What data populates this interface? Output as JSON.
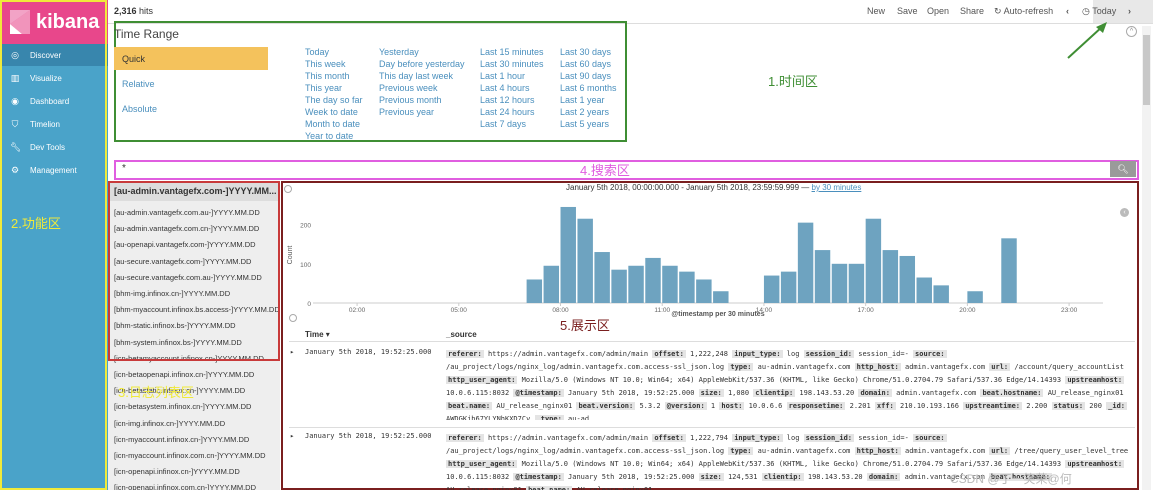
{
  "app": {
    "name": "kibana"
  },
  "sidebar": {
    "items": [
      {
        "label": "Discover",
        "icon": "compass-icon"
      },
      {
        "label": "Visualize",
        "icon": "bar-chart-icon"
      },
      {
        "label": "Dashboard",
        "icon": "dashboard-icon"
      },
      {
        "label": "Timelion",
        "icon": "shield-icon"
      },
      {
        "label": "Dev Tools",
        "icon": "wrench-icon"
      },
      {
        "label": "Management",
        "icon": "gear-icon"
      }
    ],
    "annotation": "2.功能区"
  },
  "topbar": {
    "hits_count": "2,316",
    "hits_label": "hits",
    "new": "New",
    "save": "Save",
    "open": "Open",
    "share": "Share",
    "auto_refresh": "Auto-refresh",
    "today": "Today"
  },
  "time_range": {
    "title": "Time Range",
    "types": [
      "Quick",
      "Relative",
      "Absolute"
    ],
    "col1": [
      "Today",
      "This week",
      "This month",
      "This year",
      "The day so far",
      "Week to date",
      "Month to date",
      "Year to date"
    ],
    "col2": [
      "Yesterday",
      "Day before yesterday",
      "This day last week",
      "Previous week",
      "Previous month",
      "Previous year"
    ],
    "col3": [
      "Last 15 minutes",
      "Last 30 minutes",
      "Last 1 hour",
      "Last 4 hours",
      "Last 12 hours",
      "Last 24 hours",
      "Last 7 days"
    ],
    "col4": [
      "Last 30 days",
      "Last 60 days",
      "Last 90 days",
      "Last 6 months",
      "Last 1 year",
      "Last 2 years",
      "Last 5 years"
    ],
    "annotation": "1.时间区"
  },
  "search": {
    "query": "*",
    "annotation": "4.搜索区"
  },
  "index_list": {
    "selected": "[au-admin.vantagefx.com-]YYYY.MM...",
    "items": [
      "[au-admin.vantagefx.com.au-]YYYY.MM.DD",
      "[au-admin.vantagefx.com.cn-]YYYY.MM.DD",
      "[au-openapi.vantagefx.com-]YYYY.MM.DD",
      "[au-secure.vantagefx.com-]YYYY.MM.DD",
      "[au-secure.vantagefx.com.au-]YYYY.MM.DD",
      "[bhm-img.infinox.cn-]YYYY.MM.DD",
      "[bhm-myaccount.infinox.bs.access-]YYYY.MM.DD",
      "[bhm-static.infinox.bs-]YYYY.MM.DD",
      "[bhm-system.infinox.bs-]YYYY.MM.DD",
      "[icn-betamyaccount.infinox.cn-]YYYY.MM.DD",
      "[icn-betaopenapi.infinox.cn-]YYYY.MM.DD",
      "[icn-betastatic.infinox.cn-]YYYY.MM.DD",
      "[icn-betasystem.infinox.cn-]YYYY.MM.DD",
      "[icn-img.infinox.cn-]YYYY.MM.DD",
      "[icn-myaccount.infinox.cn-]YYYY.MM.DD",
      "[icn-myaccount.infinox.com.cn-]YYYY.MM.DD",
      "[icn-openapi.infinox.cn-]YYYY.MM.DD",
      "[icn-openapi.infinox.com.cn-]YYYY.MM.DD"
    ],
    "annotation": "3.日志列表区"
  },
  "display": {
    "range_text": "January 5th 2018, 00:00:00.000 - January 5th 2018, 23:59:59.999 —",
    "interval_link": "by 30 minutes",
    "annotation": "5.展示区",
    "col_time": "Time",
    "col_source": "_source"
  },
  "chart_data": {
    "type": "bar",
    "ylabel": "Count",
    "xlabel": "@timestamp per 30 minutes",
    "ylim": [
      0,
      250
    ],
    "yticks": [
      0,
      100,
      200
    ],
    "xtick_labels": [
      "02:00",
      "05:00",
      "08:00",
      "11:00",
      "14:00",
      "17:00",
      "20:00",
      "23:00"
    ],
    "values": [
      0,
      0,
      0,
      0,
      0,
      0,
      0,
      0,
      0,
      0,
      0,
      0,
      0,
      0,
      0,
      0,
      0,
      0,
      0,
      0,
      0,
      0,
      0,
      0,
      0,
      0,
      0,
      0,
      0,
      0,
      0,
      0,
      0,
      0,
      0,
      0,
      0,
      0,
      0,
      0,
      0,
      0,
      0,
      0,
      0,
      0,
      0,
      0
    ],
    "bars": [
      {
        "x": 7.0,
        "v": 60
      },
      {
        "x": 7.5,
        "v": 95
      },
      {
        "x": 8.0,
        "v": 245
      },
      {
        "x": 8.5,
        "v": 215
      },
      {
        "x": 9.0,
        "v": 130
      },
      {
        "x": 9.5,
        "v": 85
      },
      {
        "x": 10.0,
        "v": 95
      },
      {
        "x": 10.5,
        "v": 115
      },
      {
        "x": 11.0,
        "v": 95
      },
      {
        "x": 11.5,
        "v": 80
      },
      {
        "x": 12.0,
        "v": 60
      },
      {
        "x": 12.5,
        "v": 30
      },
      {
        "x": 14.0,
        "v": 70
      },
      {
        "x": 14.5,
        "v": 80
      },
      {
        "x": 15.0,
        "v": 205
      },
      {
        "x": 15.5,
        "v": 135
      },
      {
        "x": 16.0,
        "v": 100
      },
      {
        "x": 16.5,
        "v": 100
      },
      {
        "x": 17.0,
        "v": 215
      },
      {
        "x": 17.5,
        "v": 135
      },
      {
        "x": 18.0,
        "v": 120
      },
      {
        "x": 18.5,
        "v": 65
      },
      {
        "x": 19.0,
        "v": 45
      },
      {
        "x": 20.0,
        "v": 30
      },
      {
        "x": 21.0,
        "v": 165
      }
    ]
  },
  "rows": [
    {
      "time": "January 5th 2018, 19:52:25.000",
      "fields": [
        [
          "referer:",
          "https://admin.vantagefx.com/admin/main"
        ],
        [
          "offset:",
          "1,222,248"
        ],
        [
          "input_type:",
          "log"
        ],
        [
          "session_id:",
          "session_id=-"
        ],
        [
          "source:",
          "/au_project/logs/nginx_log/admin.vantagefx.com.access-ssl_json.log"
        ],
        [
          "type:",
          "au-admin.vantagefx.com"
        ],
        [
          "http_host:",
          "admin.vantagefx.com"
        ],
        [
          "url:",
          "/account/query_accountList"
        ],
        [
          "http_user_agent:",
          "Mozilla/5.0 (Windows NT 10.0; Win64; x64) AppleWebKit/537.36 (KHTML, like Gecko) Chrome/51.0.2704.79 Safari/537.36 Edge/14.14393"
        ],
        [
          "upstreamhost:",
          "10.0.6.115:8032"
        ],
        [
          "@timestamp:",
          "January 5th 2018, 19:52:25.000"
        ],
        [
          "size:",
          "1,080"
        ],
        [
          "clientip:",
          "198.143.53.20"
        ],
        [
          "domain:",
          "admin.vantagefx.com"
        ],
        [
          "beat.hostname:",
          "AU_release_nginx01"
        ],
        [
          "beat.name:",
          "AU_release_nginx01"
        ],
        [
          "beat.version:",
          "5.3.2"
        ],
        [
          "@version:",
          "1"
        ],
        [
          "host:",
          "10.0.6.6"
        ],
        [
          "responsetime:",
          "2.201"
        ],
        [
          "xff:",
          "210.10.193.166"
        ],
        [
          "upstreamtime:",
          "2.200"
        ],
        [
          "status:",
          "200"
        ],
        [
          "_id:",
          "AWDGKjb67YLYNhKXD7Cv"
        ],
        [
          "_type:",
          "au-ad"
        ]
      ]
    },
    {
      "time": "January 5th 2018, 19:52:25.000",
      "fields": [
        [
          "referer:",
          "https://admin.vantagefx.com/admin/main"
        ],
        [
          "offset:",
          "1,222,794"
        ],
        [
          "input_type:",
          "log"
        ],
        [
          "session_id:",
          "session_id=-"
        ],
        [
          "source:",
          "/au_project/logs/nginx_log/admin.vantagefx.com.access-ssl_json.log"
        ],
        [
          "type:",
          "au-admin.vantagefx.com"
        ],
        [
          "http_host:",
          "admin.vantagefx.com"
        ],
        [
          "url:",
          "/tree/query_user_level_tree"
        ],
        [
          "http_user_agent:",
          "Mozilla/5.0 (Windows NT 10.0; Win64; x64) AppleWebKit/537.36 (KHTML, like Gecko) Chrome/51.0.2704.79 Safari/537.36 Edge/14.14393"
        ],
        [
          "upstreamhost:",
          "10.0.6.115:8032"
        ],
        [
          "@timestamp:",
          "January 5th 2018, 19:52:25.000"
        ],
        [
          "size:",
          "124,531"
        ],
        [
          "clientip:",
          "198.143.53.20"
        ],
        [
          "domain:",
          "admin.vantagefx.com"
        ],
        [
          "beat.hostname:",
          "AU_release_nginx01"
        ],
        [
          "beat.name:",
          "AU_release_nginx01"
        ]
      ]
    }
  ],
  "watermark": "CSDN @丁一笑荣@何"
}
